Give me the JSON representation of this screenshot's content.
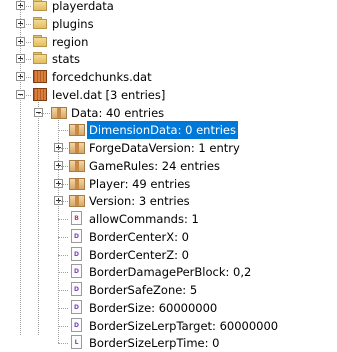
{
  "tree": {
    "root_items": [
      {
        "label": "playerdata",
        "icon": "folder-icon",
        "expander": "plus"
      },
      {
        "label": "plugins",
        "icon": "folder-icon",
        "expander": "plus"
      },
      {
        "label": "region",
        "icon": "folder-icon",
        "expander": "plus"
      },
      {
        "label": "stats",
        "icon": "folder-icon",
        "expander": "plus"
      },
      {
        "label": "forcedchunks.dat",
        "icon": "nbt-file-icon",
        "expander": "plus"
      },
      {
        "label": "level.dat [3 entries]",
        "icon": "nbt-file-icon",
        "expander": "minus"
      }
    ],
    "data_node": {
      "label": "Data: 40 entries",
      "icon": "compound-tag-icon",
      "expander": "minus"
    },
    "data_children": [
      {
        "label": "DimensionData: 0 entries",
        "icon": "compound-tag-icon",
        "expander": "none",
        "selected": true
      },
      {
        "label": "ForgeDataVersion: 1 entry",
        "icon": "compound-tag-icon",
        "expander": "plus"
      },
      {
        "label": "GameRules: 24 entries",
        "icon": "compound-tag-icon",
        "expander": "plus"
      },
      {
        "label": "Player: 49 entries",
        "icon": "compound-tag-icon",
        "expander": "plus"
      },
      {
        "label": "Version: 3 entries",
        "icon": "compound-tag-icon",
        "expander": "plus"
      },
      {
        "label": "allowCommands: 1",
        "icon": "byte-tag-icon",
        "expander": "none"
      },
      {
        "label": "BorderCenterX: 0",
        "icon": "double-tag-icon",
        "expander": "none"
      },
      {
        "label": "BorderCenterZ: 0",
        "icon": "double-tag-icon",
        "expander": "none"
      },
      {
        "label": "BorderDamagePerBlock: 0,2",
        "icon": "double-tag-icon",
        "expander": "none"
      },
      {
        "label": "BorderSafeZone: 5",
        "icon": "double-tag-icon",
        "expander": "none"
      },
      {
        "label": "BorderSize: 60000000",
        "icon": "double-tag-icon",
        "expander": "none"
      },
      {
        "label": "BorderSizeLerpTarget: 60000000",
        "icon": "double-tag-icon",
        "expander": "none"
      },
      {
        "label": "BorderSizeLerpTime: 0",
        "icon": "long-tag-icon",
        "expander": "none"
      }
    ],
    "tag_glyphs": {
      "byte": "B",
      "double": "D",
      "long": "L"
    },
    "selection_color": "#0078d7"
  }
}
